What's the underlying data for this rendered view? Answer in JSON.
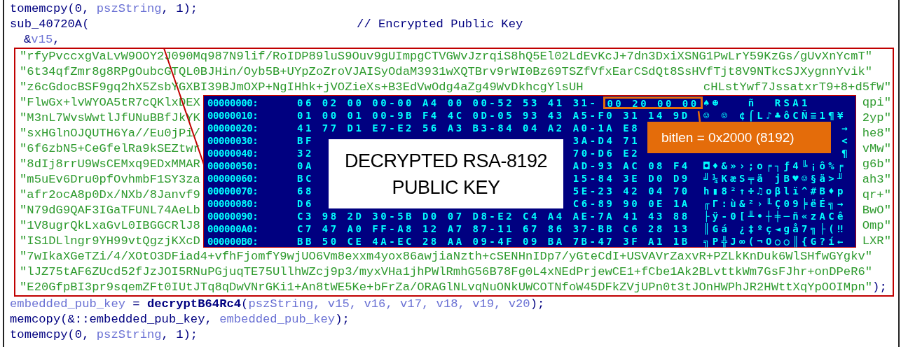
{
  "code_top": [
    {
      "tokens": [
        {
          "kind": "code",
          "text": "tomemcpy(0, "
        },
        {
          "kind": "name",
          "text": "pszString"
        },
        {
          "kind": "code",
          "text": ", 1);"
        }
      ]
    },
    {
      "tokens": [
        {
          "kind": "code",
          "text": "sub_40720A("
        },
        {
          "kind": "comment",
          "text": "// Encrypted Public Key"
        }
      ]
    },
    {
      "indented": true,
      "tokens": [
        {
          "kind": "code",
          "text": "&"
        },
        {
          "kind": "name",
          "text": "v15"
        },
        {
          "kind": "code",
          "text": ","
        }
      ]
    }
  ],
  "encrypted_strings": [
    {
      "text": "\"rfyPvccxgVaLvW9OOY2J090Mq987N9lif/RoIDP89luS9Ouv9gUImpgCTVGWvJzrqiS8hQ5El02LdEvKcJ+7dn3DxiXSNG1PwLrY59KzGs/gUvXnYcmT\""
    },
    {
      "text": "\"6t34qfZmr8g8RPgOubcGTQL0BJHin/Oyb5B+UYpZoZroVJAISyOdaM3931wXQTBrv9rWI0Bz69TSZfVfxEarCSdQt8SsHVfTjt8V9NTkcSJXygnnYvik\""
    },
    {
      "left": "\"z6cGdocBSF9gq2hX5ZsbYGXBI39BJmOXP+NgIHhk+jVOZieXs+B3EdVwOdg4aZg49WvDkhcgYlsUH",
      "right": "cHLstYwf7JssatxrT9+8+d5fW\""
    },
    {
      "left": "\"FlwGx+lvWYOA5tR7cQKlxDEX",
      "right": "qpi\""
    },
    {
      "left": "\"M3nL7WvsWwtlJfUNuBBfJkYK",
      "right": "2yp\""
    },
    {
      "left": "\"sxHGlnOJQUTH6Ya//Eu0jPi/",
      "right": "he8\""
    },
    {
      "left": "\"6f6zbN5+CeGfelRa9kSEZtwr",
      "right": "vMw\""
    },
    {
      "left": "\"8dIj8rrU9WsCEMxq9EDxMMAR",
      "right": "g6b\""
    },
    {
      "left": "\"m5uEv6Dru0pfOvhmbF1SY3za",
      "right": "ah3\""
    },
    {
      "left": "\"afr2ocA8p0Dx/NXb/8Janvf9",
      "right": "qr+\""
    },
    {
      "left": "\"N79dG9QAF3IGaTFUNL74AeLb",
      "right": "BwO\""
    },
    {
      "left": "\"1V8ugrQkLxaGvL0IBGGCRlJ8",
      "right": "Omp\""
    },
    {
      "left": "\"IS1DLlngr9YH99vtQgzjKXcD",
      "right": "LXR\""
    },
    {
      "text": "\"7wIkaXGeTZi/4/XOtO3DFiad4+vfhFjomfY9wjUO6Vm8exxm4yox86awjiaNzth+cSENHnIDp7/yGteCdI+USVAVrZaxvR+PZLkKnDuk6WlSHfwGYgkv\""
    },
    {
      "text": "\"lJZ75tAF6ZUcd52fJzJOI5RNuPGjuqTE75UllhWZcj9p3/myxVHa1jhPWlRmhG56B78Fg0L4xNEdPrjewCE1+fCbe1Ak2BLvttkWm7GsFJhr+onDPeR6\""
    },
    {
      "text": "\"E20GfpBI3pr9sqemZFt0IUtJTq8qDwVNrGKi1+An8tWE5Ke+bFrZa/ORAGlNLvqNuONkUWCOTNfoW45DFkZVjUPn0t3tJOnHWPhJR2HWttXqYpOOIMpn\"",
      "suffix": ");"
    }
  ],
  "code_bottom": [
    {
      "tokens": [
        {
          "kind": "name",
          "text": "embedded_pub_key"
        },
        {
          "kind": "code",
          "text": " = "
        },
        {
          "kind": "call",
          "text": "decryptB64Rc4"
        },
        {
          "kind": "code",
          "text": "("
        },
        {
          "kind": "name",
          "text": "pszString, v15, v16, v17, v18, v19, v20"
        },
        {
          "kind": "code",
          "text": ");"
        }
      ]
    },
    {
      "tokens": [
        {
          "kind": "code",
          "text": "memcopy(&::embedded_pub_key, "
        },
        {
          "kind": "name",
          "text": "embedded_pub_key"
        },
        {
          "kind": "code",
          "text": ");"
        }
      ]
    },
    {
      "tokens": [
        {
          "kind": "code",
          "text": "tomemcpy(0, "
        },
        {
          "kind": "name",
          "text": "pszString"
        },
        {
          "kind": "code",
          "text": ", 1);"
        }
      ]
    }
  ],
  "hex_dump": {
    "rows": [
      {
        "offset": "00000000:",
        "bytes": "06 02 00 00-00 A4 00 00-52 53 41 31-",
        "highlight": "00 20 00 00",
        "ascii": "♠☻   ñ  RSA1"
      },
      {
        "offset": "00000010:",
        "bytes": "01 00 01 00-9B F4 4C 0D-05 93 43 A5-F0 31 14 9D",
        "ascii": "☺ ☺ ¢⌠L♪♣ôCÑ≡1¶¥"
      },
      {
        "offset": "00000020:",
        "bytes": "41 77 D1 E7-E2 56 A3 B3-84 04 A2 A0-1A E8",
        "ascii_tail": "→"
      },
      {
        "offset": "00000030:",
        "bytes": "BF",
        "bytes_right": "3A-D4 71",
        "ascii_tail": "<"
      },
      {
        "offset": "00000040:",
        "bytes": "32",
        "bytes_right": "70-D6 E2",
        "ascii_tail": "¶"
      },
      {
        "offset": "00000050:",
        "bytes": "0A",
        "bytes_right": "AD-93 AC 08 F4",
        "ascii": "◘♦&»›;o╒┐ƒ4╚¡ô%╒"
      },
      {
        "offset": "00000060:",
        "bytes": "BC",
        "bytes_right": "15-84 3E D0 D9",
        "ascii": "╝¼KæS╤ä jB♥☺§ä>╜"
      },
      {
        "offset": "00000070:",
        "bytes": "68",
        "bytes_right": "5E-23 42 04 70",
        "ascii": "h▮8²↑÷♫oβlï^#B♦p"
      },
      {
        "offset": "00000080:",
        "bytes": "D6",
        "bytes_right": "C6-89 90 0E 1A",
        "ascii": "╓Γ:ù&²›╙Ç09╞ëÉ╗→"
      },
      {
        "offset": "00000090:",
        "bytes": "C3 98 2D 30-5B D0 07 D8-E2 C4 A4 AE-7A 41 43 88",
        "ascii": "├ÿ-0[╨•┼╪─ñ«zACê"
      },
      {
        "offset": "000000A0:",
        "bytes": "C7 47 A0 FF-A8 12 A7 87-11 67 86 37-BB C6 28 13",
        "ascii": "║Gá ¿‡ºç◄gå7╗├(‼"
      },
      {
        "offset": "000000B0:",
        "bytes": "BB 50 CE 4A-EC 28 AA 09-4F 09 BA 7B-47 3F A1 1B",
        "ascii": "╗P╬J∞(¬O○○║{G?í←"
      }
    ]
  },
  "caption": "DECRYPTED RSA-8192 PUBLIC KEY",
  "callout": "bitlen = 0x2000 (8192)"
}
